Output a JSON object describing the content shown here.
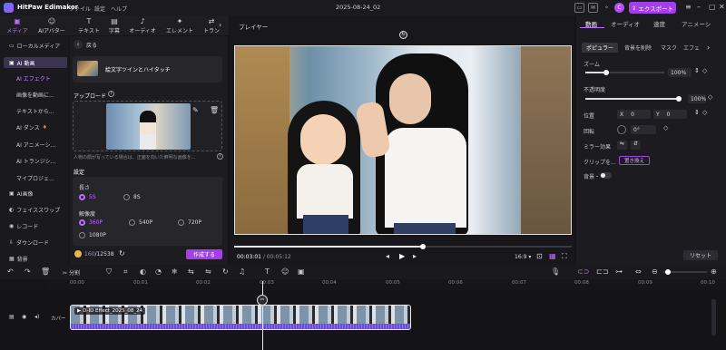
{
  "app": {
    "name": "HitPaw Edimakor",
    "menus": [
      "ファイル",
      "設定",
      "ヘルプ"
    ],
    "project": "2025-08-24_02",
    "avatar_letter": "C",
    "export_label": "エクスポート"
  },
  "toptabs": [
    {
      "label": "メディア",
      "icon": "media-icon"
    },
    {
      "label": "AIアバター",
      "icon": "avatar-icon"
    },
    {
      "label": "テキスト",
      "icon": "text-icon"
    },
    {
      "label": "字幕",
      "icon": "caption-icon"
    },
    {
      "label": "オーディオ",
      "icon": "audio-icon"
    },
    {
      "label": "エレメント",
      "icon": "element-icon"
    },
    {
      "label": "トラン",
      "icon": "transition-icon"
    }
  ],
  "leftnav": {
    "items": [
      {
        "label": "ローカルメディア"
      },
      {
        "label": "AI 動画"
      },
      {
        "label": "AI エフェクト"
      },
      {
        "label": "画像を動画に..."
      },
      {
        "label": "テキストから..."
      },
      {
        "label": "AI ダンス"
      },
      {
        "label": "AI アニメーシ..."
      },
      {
        "label": "AI トランジシ..."
      },
      {
        "label": "マイプロジェ..."
      },
      {
        "label": "AI画像"
      },
      {
        "label": "フェイススワップ"
      },
      {
        "label": "レコード"
      },
      {
        "label": "ダウンロード"
      },
      {
        "label": "背景"
      }
    ]
  },
  "midpanel": {
    "back_label": "戻る",
    "effect_title": "絵文字ツインとハイタッチ",
    "upload_label": "アップロード",
    "upload_hint": "人物の顔が写っている場合は、正面を向いた鮮明な画像を...",
    "settings_label": "設定",
    "length_label": "長さ",
    "length_options": [
      "5S",
      "8S"
    ],
    "resolution_label": "解像度",
    "resolution_options": [
      "360P",
      "540P",
      "720P",
      "1080P"
    ],
    "credits_used": "160",
    "credits_total": "/12538",
    "create_label": "作成する"
  },
  "player": {
    "title": "プレイヤー",
    "current_time": "00:03:01",
    "total_time": "/ 00:05:12",
    "aspect": "16:9",
    "progress": 0.56
  },
  "props": {
    "tabs": [
      "動画",
      "オーディオ",
      "速度",
      "アニメーシ"
    ],
    "subtabs": [
      "ポピュラー",
      "背景を削除",
      "マスク",
      "エフェ"
    ],
    "zoom_label": "ズーム",
    "zoom_value": "100%",
    "opacity_label": "不透明度",
    "opacity_value": "100%",
    "position_label": "位置",
    "pos_x_label": "X",
    "pos_x": "0",
    "pos_y_label": "Y",
    "pos_y": "0",
    "rotate_label": "回転",
    "rotate_value": "0°",
    "mirror_label": "ミラー効果",
    "clip_label": "クリップを...",
    "replace_label": "置き換え",
    "bg_label": "背景・",
    "reset_label": "リセット"
  },
  "timeline": {
    "split_label": "分割",
    "ruler": [
      "00:00",
      "00:01",
      "00:02",
      "00:03",
      "00:04",
      "00:05",
      "00:06",
      "00:07",
      "00:08",
      "00:09",
      "00:10"
    ],
    "cover_label": "カバー",
    "clip_name": "D-ID Effect_2025_08_24"
  }
}
